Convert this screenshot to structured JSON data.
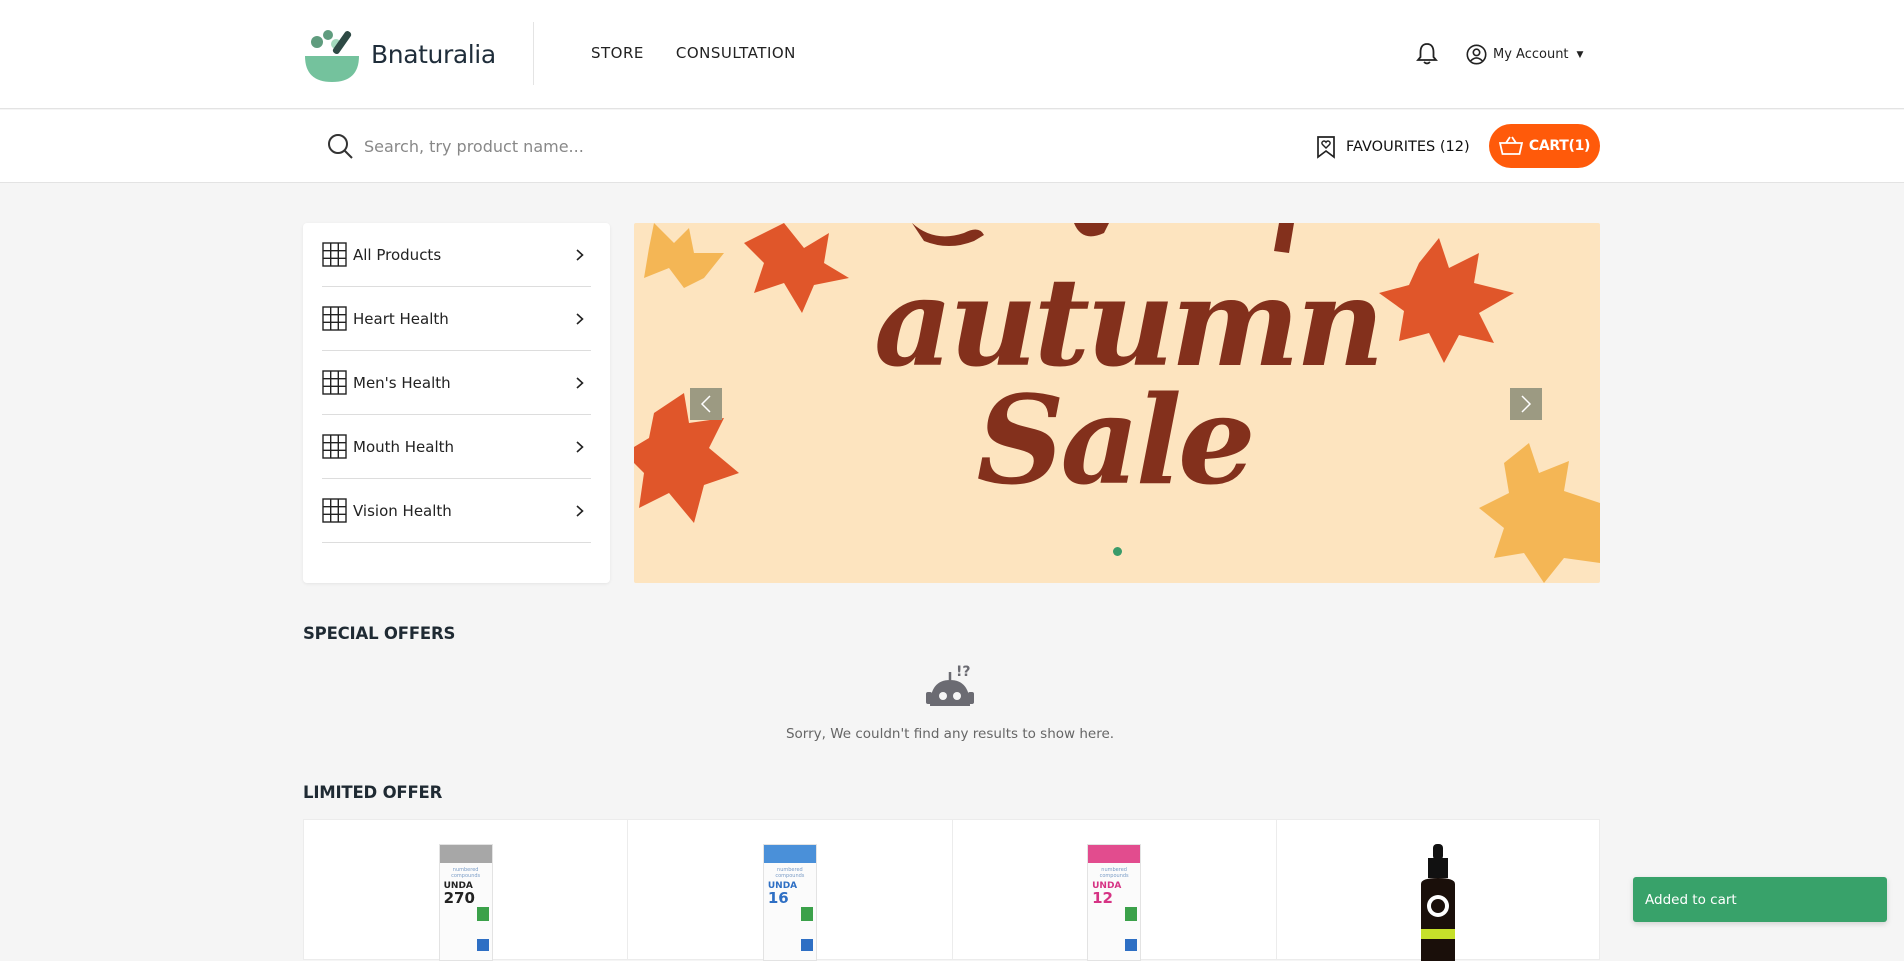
{
  "header": {
    "brand": "Bnaturalia",
    "nav": [
      {
        "label": "STORE",
        "icon": ""
      },
      {
        "label": "CONSULTATION",
        "icon": ""
      }
    ],
    "notification_icon": "bell-icon",
    "account_label": "My Account"
  },
  "search": {
    "placeholder": "Search, try product name...",
    "value": "",
    "favourites_label": "FAVOURITES (12)",
    "cart_label": "CART(1)"
  },
  "categories": [
    {
      "label": "All Products",
      "icon": "grid-icon"
    },
    {
      "label": "Heart Health",
      "icon": "grid-icon"
    },
    {
      "label": "Men's Health",
      "icon": "grid-icon"
    },
    {
      "label": "Mouth Health",
      "icon": "grid-icon"
    },
    {
      "label": "Vision Health",
      "icon": "grid-icon"
    }
  ],
  "hero": {
    "headline_line1": "autumn",
    "headline_line2": "Sale",
    "slides_count": 1,
    "active_slide": 1
  },
  "special_offers": {
    "title": "SPECIAL OFFERS",
    "empty_message": "Sorry, We couldn't find any results to show here."
  },
  "limited_offer": {
    "title": "LIMITED OFFER",
    "products": [
      {
        "brand_text": "numbered compounds",
        "code": "UNDA",
        "number": "270",
        "cap_color": "#a7a7a7"
      },
      {
        "brand_text": "numbered compounds",
        "code": "UNDA",
        "number": "16",
        "cap_color": "#4a90d9"
      },
      {
        "brand_text": "numbered compounds",
        "code": "UNDA",
        "number": "12",
        "cap_color": "#e24c8e"
      },
      {
        "brand_text": "",
        "code": "",
        "number": "",
        "cap_color": "#111111"
      }
    ]
  },
  "toast": {
    "message": "Added to cart"
  },
  "colors": {
    "accent": "#ff5a0a",
    "brand_green": "#3a9b6a",
    "toast": "#38a26a"
  }
}
